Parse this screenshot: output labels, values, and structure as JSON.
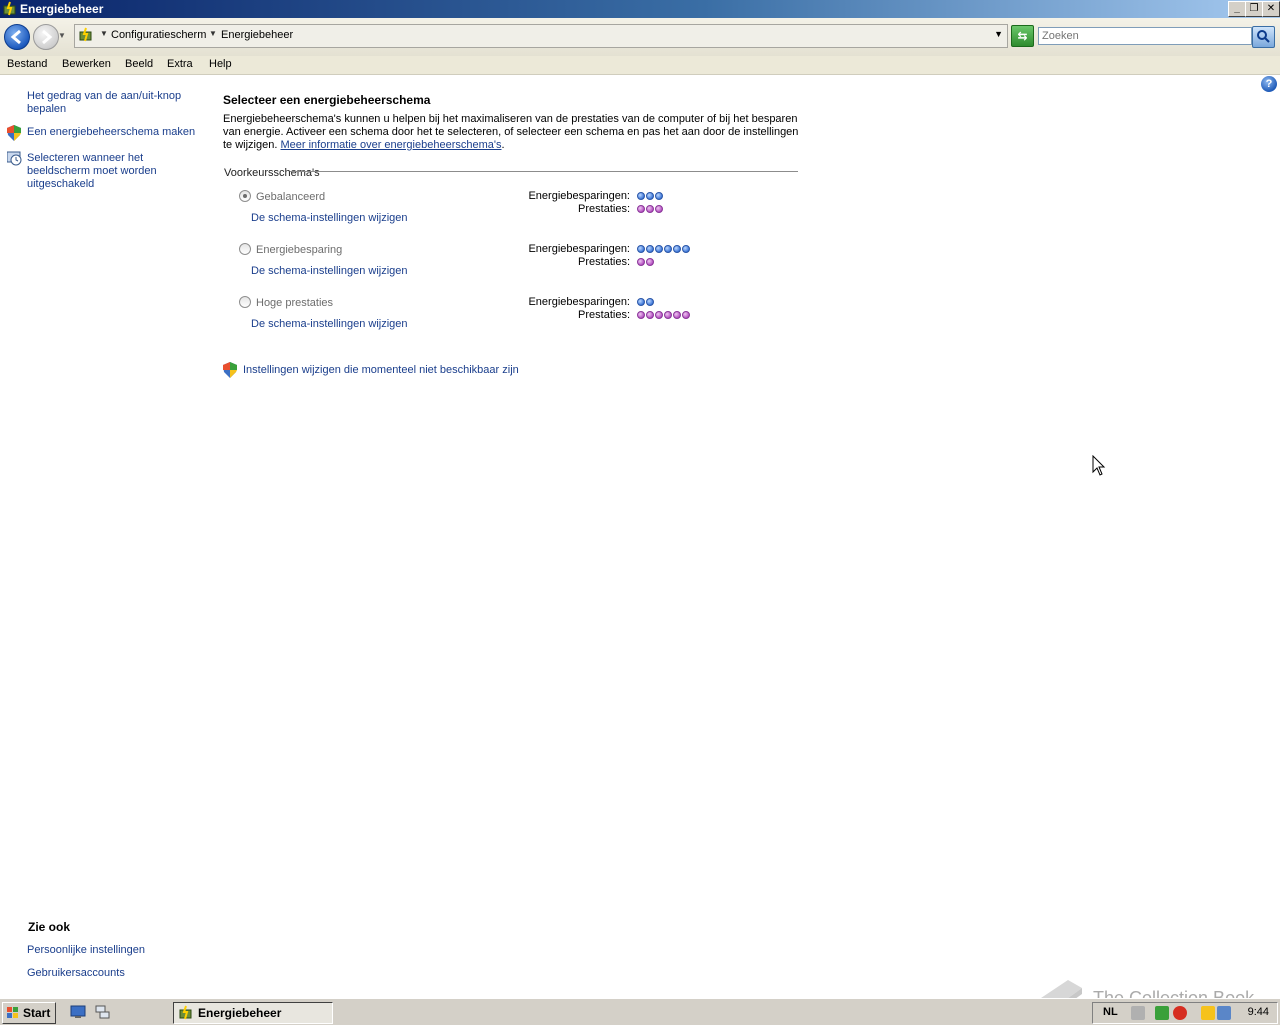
{
  "window": {
    "title": "Energiebeheer"
  },
  "address": {
    "breadcrumbs": [
      "Configuratiescherm",
      "Energiebeheer"
    ],
    "search_placeholder": "Zoeken"
  },
  "menu": [
    "Bestand",
    "Bewerken",
    "Beeld",
    "Extra",
    "Help"
  ],
  "sidebar": {
    "tasks": [
      {
        "label": "Het gedrag van de aan/uit-knop bepalen",
        "lines": [
          "Het gedrag van de aan/uit-knop",
          "bepalen"
        ],
        "icon": "none"
      },
      {
        "label": "Een energiebeheerschema maken",
        "lines": [
          "Een energiebeheerschema maken"
        ],
        "icon": "shield-icon"
      },
      {
        "label": "Selecteren wanneer het beeldscherm moet worden uitgeschakeld",
        "lines": [
          "Selecteren wanneer het",
          "beeldscherm moet worden",
          "uitgeschakeld"
        ],
        "icon": "display-clock-icon"
      }
    ],
    "see_also_title": "Zie ook",
    "see_also": [
      "Persoonlijke instellingen",
      "Gebruikersaccounts"
    ]
  },
  "main": {
    "title": "Selecteer een energiebeheerschema",
    "description": "Energiebeheerschema's kunnen u helpen bij het maximaliseren van de prestaties van de computer of bij het besparen van energie. Activeer een schema door het te selecteren, of selecteer een schema en pas het aan door de instellingen te wijzigen.",
    "more_info_link": "Meer informatie over energiebeheerschema's",
    "group_label": "Voorkeursschema's",
    "savings_label": "Energiebesparingen:",
    "performance_label": "Prestaties:",
    "plans": [
      {
        "name": "Gebalanceerd",
        "selected": true,
        "change_link": "De schema-instellingen wijzigen",
        "savings": 3,
        "performance": 3
      },
      {
        "name": "Energiebesparing",
        "selected": false,
        "change_link": "De schema-instellingen wijzigen",
        "savings": 6,
        "performance": 2
      },
      {
        "name": "Hoge prestaties",
        "selected": false,
        "change_link": "De schema-instellingen wijzigen",
        "savings": 2,
        "performance": 6
      }
    ],
    "unavailable_settings_link": "Instellingen wijzigen die momenteel niet beschikbaar zijn"
  },
  "taskbar": {
    "start_label": "Start",
    "open_windows": [
      "Energiebeheer"
    ],
    "language": "NL",
    "clock": "9:44"
  },
  "watermark": "The Collection Book",
  "colors": {
    "link": "#1a3e8c",
    "savings_dot": "#3f78d8",
    "performance_dot": "#b552c2"
  }
}
